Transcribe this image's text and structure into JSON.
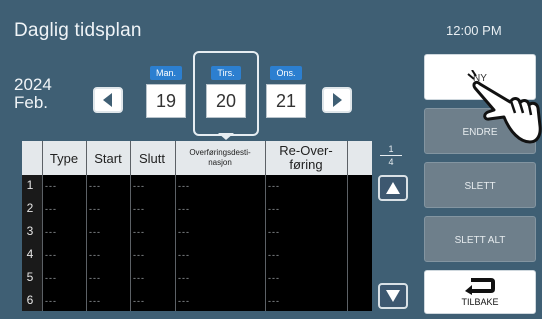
{
  "header": {
    "title": "Daglig tidsplan",
    "clock": "12:00 PM"
  },
  "date": {
    "year": "2024",
    "month": "Feb."
  },
  "days": [
    {
      "label": "Man.",
      "number": "19"
    },
    {
      "label": "Tirs.",
      "number": "20"
    },
    {
      "label": "Ons.",
      "number": "21"
    }
  ],
  "selected_day": "Tirs.",
  "table": {
    "columns": [
      "Type",
      "Start",
      "Slutt",
      "Overføringsdesti-nasjon",
      "Re-Over-føring"
    ],
    "column_lines": {
      "destination": [
        "Overføringsdesti-",
        "nasjon"
      ],
      "retransfer": [
        "Re-Over-",
        "føring"
      ]
    },
    "rows": [
      {
        "num": "1",
        "cells": [
          "---",
          "---",
          "---",
          "---",
          "---"
        ]
      },
      {
        "num": "2",
        "cells": [
          "---",
          "---",
          "---",
          "---",
          "---"
        ]
      },
      {
        "num": "3",
        "cells": [
          "---",
          "---",
          "---",
          "---",
          "---"
        ]
      },
      {
        "num": "4",
        "cells": [
          "---",
          "---",
          "---",
          "---",
          "---"
        ]
      },
      {
        "num": "5",
        "cells": [
          "---",
          "---",
          "---",
          "---",
          "---"
        ]
      },
      {
        "num": "6",
        "cells": [
          "---",
          "---",
          "---",
          "---",
          "---"
        ]
      }
    ]
  },
  "pager": {
    "current": "1",
    "total": "4"
  },
  "side_buttons": [
    {
      "label": "NY",
      "state": "active"
    },
    {
      "label": "ENDRE",
      "state": "disabled"
    },
    {
      "label": "SLETT",
      "state": "disabled"
    },
    {
      "label": "SLETT ALT",
      "state": "disabled"
    }
  ],
  "back_button": {
    "label": "TILBAKE",
    "icon": "return-arrow-icon"
  },
  "colors": {
    "background": "#3f5f74",
    "accent": "#2c7fd0",
    "table_bg": "#000000"
  }
}
